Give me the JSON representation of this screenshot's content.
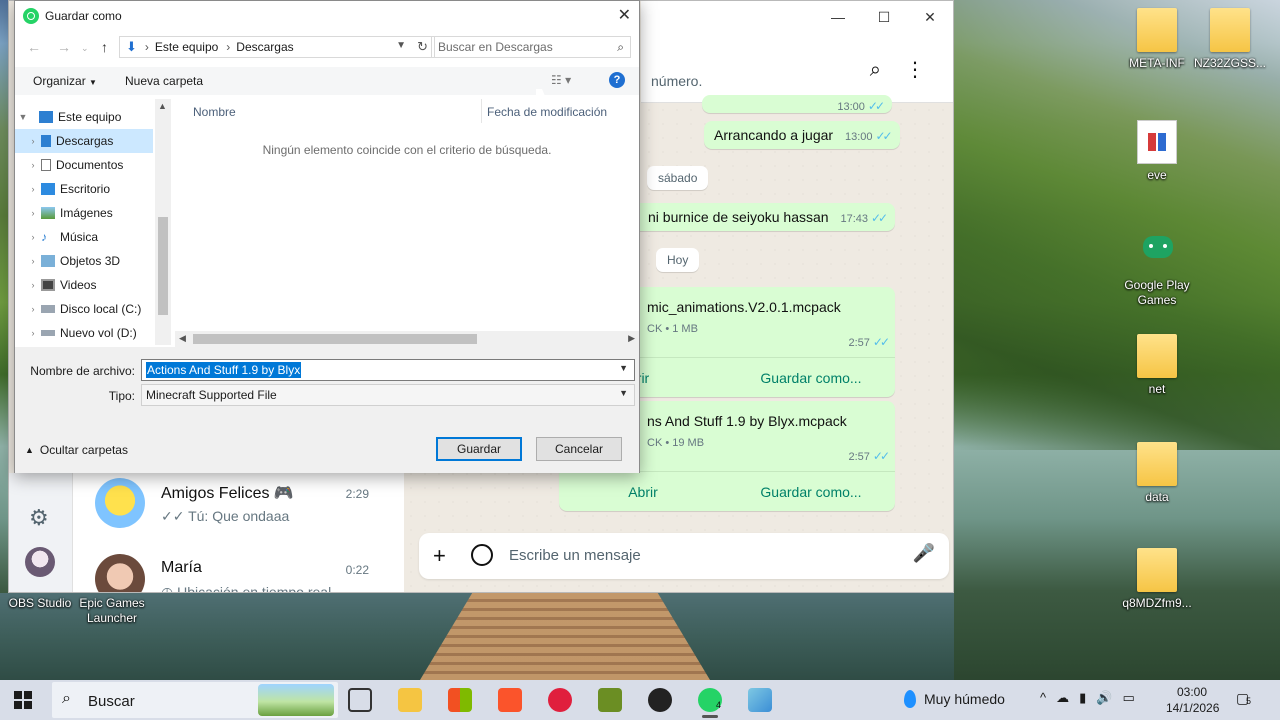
{
  "desktop": {
    "icons": [
      {
        "label": "META-INF"
      },
      {
        "label": "NZ32ZGSS..."
      },
      {
        "label": "eve"
      },
      {
        "label": "Google Play Games"
      },
      {
        "label": "net"
      },
      {
        "label": "data"
      },
      {
        "label": "q8MDZfm9..."
      },
      {
        "label": "OBS Studio"
      },
      {
        "label": "Epic Games Launcher"
      }
    ]
  },
  "whatsapp": {
    "header_text": "número.",
    "messages": [
      {
        "text": "Arrancando a jugar",
        "time": "13:00"
      },
      {
        "text": "ni burnice de seiyoku hassan",
        "time": "17:43"
      }
    ],
    "partial_time": "13:00",
    "day_chips": [
      "sábado",
      "Hoy"
    ],
    "files": [
      {
        "name": "mic_animations.V2.0.1.mcpack",
        "meta": "CK • 1 MB",
        "time": "2:57",
        "open": "rir",
        "save": "Guardar como..."
      },
      {
        "name": "ns And Stuff 1.9 by Blyx.mcpack",
        "meta": "CK • 19 MB",
        "time": "2:57",
        "open": "Abrir",
        "save": "Guardar como..."
      }
    ],
    "composer_placeholder": "Escribe un mensaje",
    "chats": [
      {
        "name": "Amigos Felices 🎮",
        "time": "2:29",
        "preview": "✓✓ Tú: Que ondaaa"
      },
      {
        "name": "María",
        "time": "0:22",
        "preview": "◷ Ubicación en tiempo real"
      }
    ]
  },
  "dialog": {
    "title": "Guardar como",
    "breadcrumb": [
      "Este equipo",
      "Descargas"
    ],
    "search_placeholder": "Buscar en Descargas",
    "organize": "Organizar",
    "new_folder": "Nueva carpeta",
    "help": "?",
    "tree": [
      {
        "label": "Este equipo"
      },
      {
        "label": "Descargas"
      },
      {
        "label": "Documentos"
      },
      {
        "label": "Escritorio"
      },
      {
        "label": "Imágenes"
      },
      {
        "label": "Música"
      },
      {
        "label": "Objetos 3D"
      },
      {
        "label": "Videos"
      },
      {
        "label": "Disco local (C:)"
      },
      {
        "label": "Nuevo vol (D:)"
      }
    ],
    "columns": [
      "Nombre",
      "Fecha de modificación"
    ],
    "empty_message": "Ningún elemento coincide con el criterio de búsqueda.",
    "filename_label": "Nombre de archivo:",
    "filename_value": "Actions And Stuff 1.9 by Blyx",
    "type_label": "Tipo:",
    "type_value": "Minecraft Supported File",
    "hide_folders": "Ocultar carpetas",
    "save_button": "Guardar",
    "cancel_button": "Cancelar"
  },
  "taskbar": {
    "search_text": "Buscar",
    "weather": "Muy húmedo",
    "time": "03:00",
    "date": "14/1/2026",
    "whatsapp_badge": "4",
    "notifications": "5"
  },
  "colors": {
    "whatsapp_green": "#25d366",
    "bubble": "#d9fdd3",
    "selection": "#0078d7",
    "tree_selected": "#cce8ff"
  }
}
